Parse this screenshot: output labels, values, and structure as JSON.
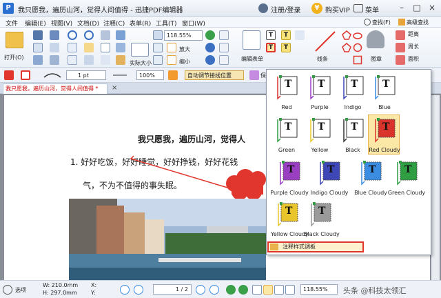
{
  "titlebar": {
    "logo": "P",
    "title": "我只愿我，遍历山河，觉得人间值得 - 迅捷PDF编辑器",
    "login": "注册/登录",
    "vip_badge": "¥",
    "vip": "购买VIP",
    "menu": "菜单",
    "minimize": "–",
    "maximize": "□",
    "close": "×"
  },
  "menubar": {
    "items": [
      "文件",
      "编辑(E)",
      "视图(V)",
      "文档(D)",
      "注释(C)",
      "表单(R)",
      "工具(T)",
      "窗口(W)"
    ],
    "find": "查找(F)",
    "advanced": "高级查找"
  },
  "ribbon": {
    "open": "打开(O)",
    "zoom_value": "118.55%",
    "actual_size": "实际大小",
    "zoom_in": "放大",
    "zoom_out": "缩小",
    "edit_form": "编辑表单",
    "lines": "线条",
    "stamp": "图章",
    "distance": "距离",
    "perimeter": "周长",
    "area": "面积"
  },
  "toolbar2": {
    "stroke_width": "1 pt",
    "opacity": "100%",
    "auto_adjust": "自动调节接线位置",
    "lock": "保"
  },
  "tab": {
    "title": "我只愿我，遍历山河，觉得人间值得 *",
    "close": "×"
  },
  "document": {
    "heading": "我只愿我，遍历山河，觉得人",
    "line1": "1.  好好吃饭，好好睡觉，好好挣钱，好好花钱",
    "line2": "气，不为不值得的事失眠。"
  },
  "popup": {
    "styles": [
      {
        "name": "Red",
        "color": "#d9342b"
      },
      {
        "name": "Purple",
        "color": "#9b3fc2"
      },
      {
        "name": "Indigo",
        "color": "#3d47b5"
      },
      {
        "name": "Blue",
        "color": "#3a8de0"
      },
      {
        "name": "Green",
        "color": "#2f9e42"
      },
      {
        "name": "Yellow",
        "color": "#e8c52b"
      },
      {
        "name": "Black",
        "color": "#333333"
      },
      {
        "name": "Red Cloudy",
        "color": "#d9342b"
      },
      {
        "name": "Purple Cloudy",
        "color": "#9b3fc2"
      },
      {
        "name": "Indigo Cloudy",
        "color": "#3d47b5"
      },
      {
        "name": "Blue Cloudy",
        "color": "#3a8de0"
      },
      {
        "name": "Green Cloudy",
        "color": "#2f9e42"
      },
      {
        "name": "Yellow Cloudy",
        "color": "#e8c52b"
      },
      {
        "name": "Black Cloudy",
        "color": "#9a9a9a"
      }
    ],
    "selected": "Red Cloudy",
    "footer": "注释样式调板",
    "glyph": "T"
  },
  "statusbar": {
    "options": "选项",
    "width": "W: 210.0mm",
    "height": "H: 297.0mm",
    "x": "X:",
    "y": "Y:",
    "page_value": "1",
    "page_total": "/ 2",
    "zoom": "118.55%",
    "watermark": "头条 @科技太领汇"
  }
}
